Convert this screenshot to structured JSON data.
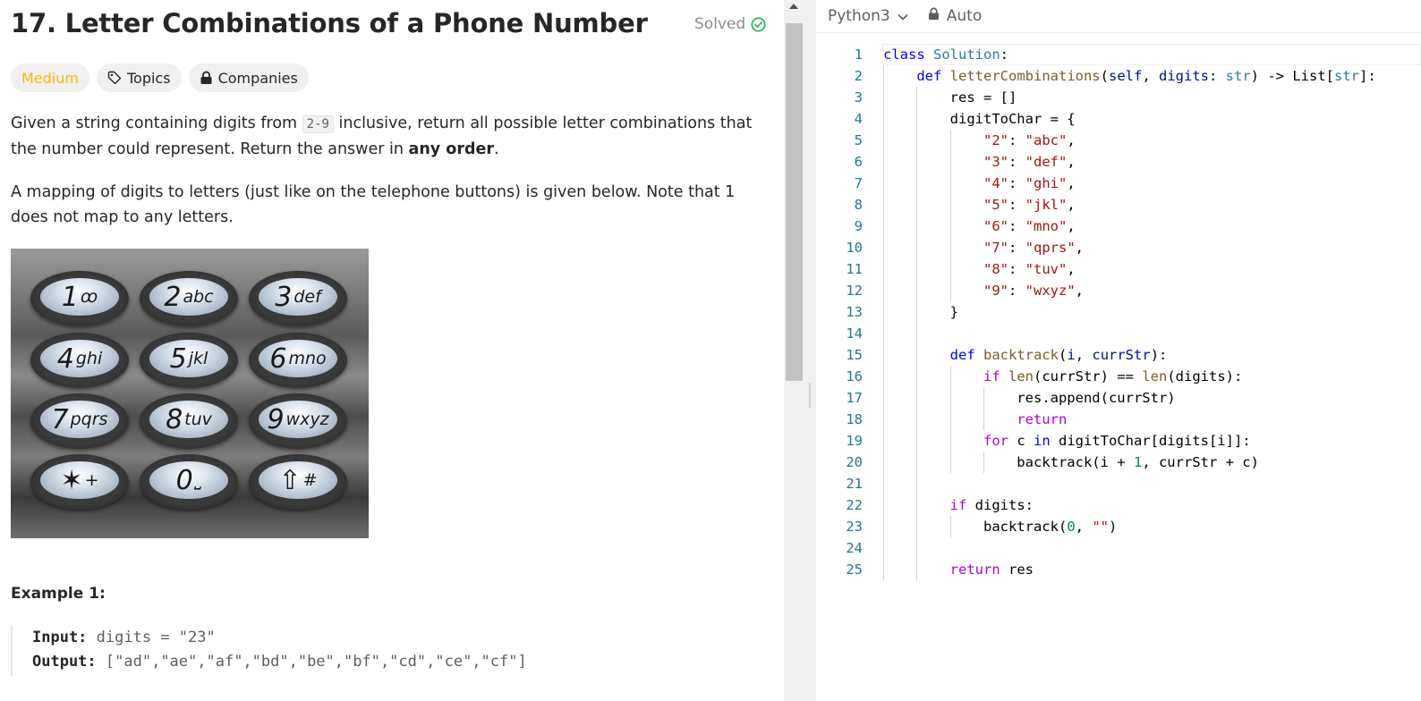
{
  "problem": {
    "title": "17. Letter Combinations of a Phone Number",
    "solved_label": "Solved",
    "difficulty": "Medium",
    "topics_label": "Topics",
    "companies_label": "Companies",
    "p1_before": "Given a string containing digits from ",
    "p1_code": "2-9",
    "p1_middle": " inclusive, return all possible letter combinations that the number could represent. Return the answer in ",
    "p1_bold": "any order",
    "p1_end": ".",
    "p2": "A mapping of digits to letters (just like on the telephone buttons) is given below. Note that 1 does not map to any letters.",
    "keypad": [
      {
        "digit": "1",
        "letters": "ꝏ"
      },
      {
        "digit": "2",
        "letters": "abc"
      },
      {
        "digit": "3",
        "letters": "def"
      },
      {
        "digit": "4",
        "letters": "ghi"
      },
      {
        "digit": "5",
        "letters": "jkl"
      },
      {
        "digit": "6",
        "letters": "mno"
      },
      {
        "digit": "7",
        "letters": "pqrs"
      },
      {
        "digit": "8",
        "letters": "tuv"
      },
      {
        "digit": "9",
        "letters": "wxyz"
      },
      {
        "digit": "✶",
        "letters": "+"
      },
      {
        "digit": "0",
        "letters": "⎵"
      },
      {
        "digit": "⇧",
        "letters": "#"
      }
    ],
    "example_heading": "Example 1:",
    "example_input_label": "Input:",
    "example_input_value": "digits = \"23\"",
    "example_output_label": "Output:",
    "example_output_value": "[\"ad\",\"ae\",\"af\",\"bd\",\"be\",\"bf\",\"cd\",\"ce\",\"cf\"]"
  },
  "editor": {
    "language": "Python3",
    "mode": "Auto",
    "code_lines": [
      [
        [
          "class",
          "kw"
        ],
        [
          " ",
          ""
        ],
        [
          "Solution",
          "cls"
        ],
        [
          ":",
          ""
        ]
      ],
      [
        [
          "    ",
          ""
        ],
        [
          "def",
          "kw"
        ],
        [
          " ",
          ""
        ],
        [
          "letterCombinations",
          "fn"
        ],
        [
          "(",
          ""
        ],
        [
          "self",
          "prm"
        ],
        [
          ", ",
          ""
        ],
        [
          "digits",
          "prm"
        ],
        [
          ": ",
          ""
        ],
        [
          "str",
          "cls"
        ],
        [
          ") -> List[",
          ""
        ],
        [
          "str",
          "cls"
        ],
        [
          "]:",
          ""
        ]
      ],
      [
        [
          "        res = []",
          ""
        ]
      ],
      [
        [
          "        digitToChar = {",
          ""
        ]
      ],
      [
        [
          "            ",
          ""
        ],
        [
          "\"2\"",
          "str"
        ],
        [
          ": ",
          ""
        ],
        [
          "\"abc\"",
          "str"
        ],
        [
          ",",
          ""
        ]
      ],
      [
        [
          "            ",
          ""
        ],
        [
          "\"3\"",
          "str"
        ],
        [
          ": ",
          ""
        ],
        [
          "\"def\"",
          "str"
        ],
        [
          ",",
          ""
        ]
      ],
      [
        [
          "            ",
          ""
        ],
        [
          "\"4\"",
          "str"
        ],
        [
          ": ",
          ""
        ],
        [
          "\"ghi\"",
          "str"
        ],
        [
          ",",
          ""
        ]
      ],
      [
        [
          "            ",
          ""
        ],
        [
          "\"5\"",
          "str"
        ],
        [
          ": ",
          ""
        ],
        [
          "\"jkl\"",
          "str"
        ],
        [
          ",",
          ""
        ]
      ],
      [
        [
          "            ",
          ""
        ],
        [
          "\"6\"",
          "str"
        ],
        [
          ": ",
          ""
        ],
        [
          "\"mno\"",
          "str"
        ],
        [
          ",",
          ""
        ]
      ],
      [
        [
          "            ",
          ""
        ],
        [
          "\"7\"",
          "str"
        ],
        [
          ": ",
          ""
        ],
        [
          "\"qprs\"",
          "str"
        ],
        [
          ",",
          ""
        ]
      ],
      [
        [
          "            ",
          ""
        ],
        [
          "\"8\"",
          "str"
        ],
        [
          ": ",
          ""
        ],
        [
          "\"tuv\"",
          "str"
        ],
        [
          ",",
          ""
        ]
      ],
      [
        [
          "            ",
          ""
        ],
        [
          "\"9\"",
          "str"
        ],
        [
          ": ",
          ""
        ],
        [
          "\"wxyz\"",
          "str"
        ],
        [
          ",",
          ""
        ]
      ],
      [
        [
          "        }",
          ""
        ]
      ],
      [],
      [
        [
          "        ",
          ""
        ],
        [
          "def",
          "kw"
        ],
        [
          " ",
          ""
        ],
        [
          "backtrack",
          "fn"
        ],
        [
          "(",
          ""
        ],
        [
          "i",
          "prm"
        ],
        [
          ", ",
          ""
        ],
        [
          "currStr",
          "prm"
        ],
        [
          "):",
          ""
        ]
      ],
      [
        [
          "            ",
          ""
        ],
        [
          "if",
          "kw2"
        ],
        [
          " ",
          ""
        ],
        [
          "len",
          "fn"
        ],
        [
          "(currStr) == ",
          ""
        ],
        [
          "len",
          "fn"
        ],
        [
          "(digits):",
          ""
        ]
      ],
      [
        [
          "                res.append(currStr)",
          ""
        ]
      ],
      [
        [
          "                ",
          ""
        ],
        [
          "return",
          "kw2"
        ]
      ],
      [
        [
          "            ",
          ""
        ],
        [
          "for",
          "kw2"
        ],
        [
          " c ",
          ""
        ],
        [
          "in",
          "kw"
        ],
        [
          " digitToChar[digits[i]]:",
          ""
        ]
      ],
      [
        [
          "                backtrack(i + ",
          ""
        ],
        [
          "1",
          "num"
        ],
        [
          ", currStr + c)",
          ""
        ]
      ],
      [],
      [
        [
          "        ",
          ""
        ],
        [
          "if",
          "kw2"
        ],
        [
          " digits:",
          ""
        ]
      ],
      [
        [
          "            backtrack(",
          ""
        ],
        [
          "0",
          "num"
        ],
        [
          ", ",
          ""
        ],
        [
          "\"\"",
          "str"
        ],
        [
          ")",
          ""
        ]
      ],
      [],
      [
        [
          "        ",
          ""
        ],
        [
          "return",
          "kw2"
        ],
        [
          " res",
          ""
        ]
      ]
    ]
  }
}
